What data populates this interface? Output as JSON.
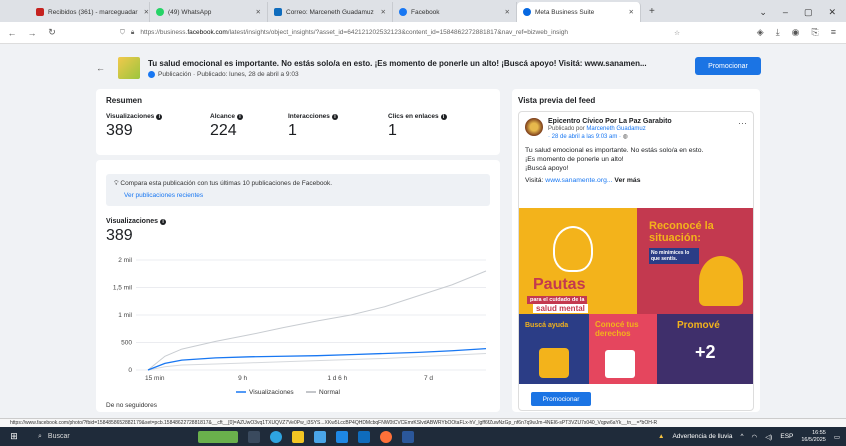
{
  "browser": {
    "tabs": [
      {
        "label": "Recibidos (361) - marceguadar",
        "color": "#c5221f"
      },
      {
        "label": "(49) WhatsApp",
        "color": "#25d366"
      },
      {
        "label": "Correo: Marceneth Guadamuz",
        "color": "#0f6cbd"
      },
      {
        "label": "Facebook",
        "color": "#1877f2"
      },
      {
        "label": "Meta Business Suite",
        "color": "#0668e1",
        "active": true
      }
    ],
    "url_prefix": "https://business.",
    "url_domain": "facebook.com",
    "url_rest": "/latest/insights/object_insights/?asset_id=642121202532123&content_id=1584862272881817&nav_ref=bizweb_insigh"
  },
  "post": {
    "title": "Tu salud emocional es importante. No estás solo/a en esto. ¡Es momento de ponerle un alto! ¡Buscá apoyo! Visitá: www.sanamen...",
    "subtitle": "Publicación · Publicado: lunes, 28 de abril a 9:03",
    "promote_label": "Promocionar"
  },
  "summary": {
    "title": "Resumen",
    "metrics": [
      {
        "label": "Visualizaciones",
        "value": "389"
      },
      {
        "label": "Alcance",
        "value": "224"
      },
      {
        "label": "Interacciones",
        "value": "1"
      },
      {
        "label": "Clics en enlaces",
        "value": "1"
      }
    ]
  },
  "compare": {
    "text": "Compara esta publicación con tus últimas 10 publicaciones de Facebook.",
    "link": "Ver publicaciones recientes"
  },
  "views": {
    "label": "Visualizaciones",
    "value": "389"
  },
  "chart_data": {
    "type": "line",
    "x_ticks": [
      "15 min",
      "9 h",
      "1 d 6 h",
      "7 d"
    ],
    "y_ticks": [
      "0",
      "500",
      "1 mil",
      "1,5 mil",
      "2 mil"
    ],
    "ylim": [
      0,
      2000
    ],
    "series": [
      {
        "name": "Visualizaciones",
        "color": "#1877f2",
        "x": [
          0,
          0.05,
          0.1,
          0.2,
          0.3,
          0.4,
          0.5,
          0.6,
          0.7,
          0.8,
          0.9,
          1.0
        ],
        "values": [
          0,
          120,
          180,
          220,
          240,
          250,
          260,
          280,
          300,
          320,
          350,
          389
        ]
      },
      {
        "name": "Normal",
        "color": "#c8ccd1",
        "x": [
          0,
          0.05,
          0.1,
          0.2,
          0.3,
          0.4,
          0.5,
          0.6,
          0.7,
          0.8,
          0.9,
          1.0
        ],
        "values": [
          0,
          250,
          380,
          520,
          640,
          770,
          890,
          1000,
          1150,
          1350,
          1550,
          1800
        ]
      }
    ],
    "series_lower": {
      "name": "",
      "color": "#d6d9dd",
      "values": [
        0,
        60,
        90,
        110,
        130,
        150,
        170,
        190,
        210,
        240,
        270,
        300
      ]
    }
  },
  "nofollow": "De no seguidores",
  "preview": {
    "title": "Vista previa del feed",
    "author": "Epicentro Cívico Por La Paz Garabito",
    "published_by_prefix": "Publicado por",
    "published_by": "Marceneth Guadamuz",
    "date": "· 28 de abril a las 9:03 am · ",
    "text1": "Tu salud emocional es  importante. No estás  solo/a en esto.",
    "text2": "¡Es momento de ponerle un alto!",
    "text3": "¡Buscá apoyo!",
    "visit_prefix": "Visitá:",
    "visit_link": "www.sanamente.org...",
    "see_more": "Ver más",
    "tiles": {
      "t1_title": "Pautas",
      "t1_sub": "para el cuidado de la",
      "t1_sub2": "salud mental",
      "t2_title": "Reconocé la situación:",
      "t2_sub": "No minimices lo que sentís.",
      "t3_title": "Buscá ayuda",
      "t4_title": "Conocé tus derechos",
      "t5_title": "Promové",
      "t5_plus": "+2"
    },
    "promote_label": "Promocionar"
  },
  "status_url": "https://www.facebook.com/photo/?fbid=1584858652882179&set=pcb.1584862272881817&__cft__[0]=AZUwO3vq1TXUQVZ7Ve0Pw_i3SYS...XKw5LccBP4QHDMcbqFNW0tCVCEmrKSlvdABWRYbOOtaFLx-hV_lgff6fZuwNzGp_nf6n7q9wJm-4NEl6-sPT3VZU7x040_Vqpw6aYk__tn__=*bOH-R",
  "taskbar": {
    "search": "Buscar",
    "weather": "Advertencia de lluvia",
    "lang": "ESP",
    "time": "16:55",
    "date": "16/5/2025"
  }
}
